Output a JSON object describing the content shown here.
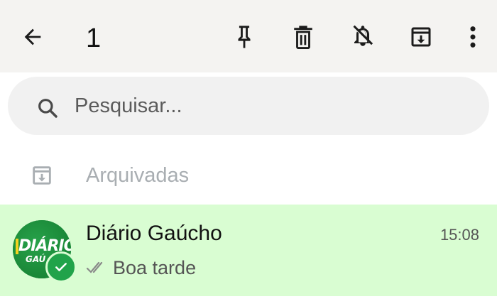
{
  "header": {
    "selected_count": "1",
    "icons": [
      "back-arrow-icon",
      "pin-icon",
      "trash-icon",
      "bell-off-icon",
      "archive-icon",
      "more-vert-icon"
    ]
  },
  "search": {
    "placeholder": "Pesquisar..."
  },
  "archived": {
    "label": "Arquivadas"
  },
  "chats": [
    {
      "name": "Diário Gaúcho",
      "time": "15:08",
      "preview": "Boa tarde",
      "avatar_text": [
        "DIÁRIO",
        "GAÚ"
      ],
      "selected": true
    }
  ],
  "colors": {
    "topbar_bg": "#f4f3f1",
    "selected_row_bg": "#d9fdd2",
    "accent_green": "#21a34a"
  }
}
